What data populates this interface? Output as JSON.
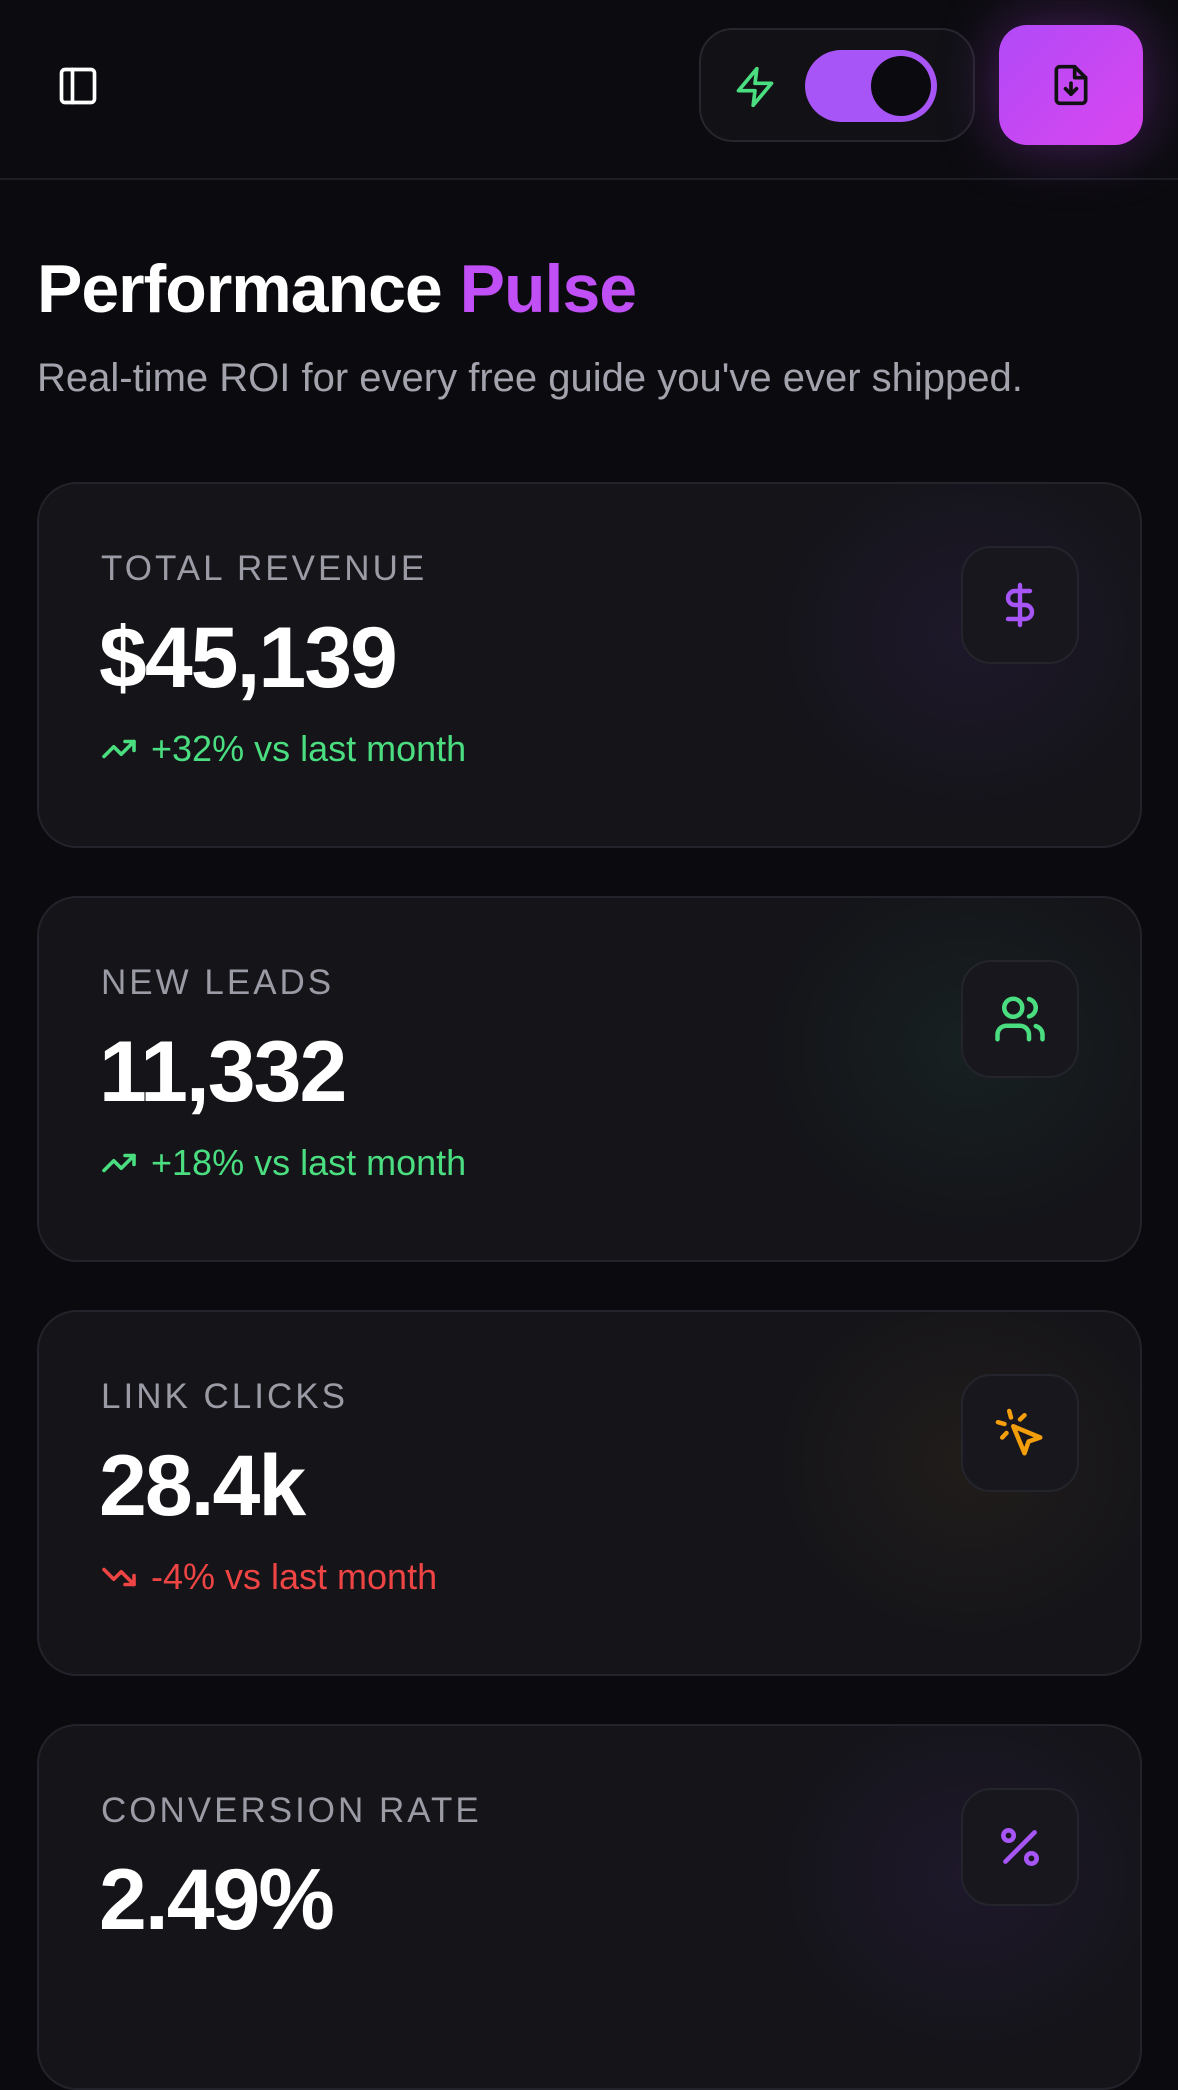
{
  "header": {
    "sidebar_icon": "sidebar-toggle-icon",
    "bolt_icon": "bolt-icon",
    "toggle_on": true,
    "export_icon": "file-download-icon",
    "colors": {
      "toggle": "#a855f7",
      "export_from": "#b14af7",
      "export_to": "#d946ef",
      "bolt": "#4ade80"
    }
  },
  "page": {
    "title_main": "Performance",
    "title_accent": "Pulse",
    "subtitle": "Real-time ROI for every free guide you've ever shipped.",
    "accent_color": "#c04ff5"
  },
  "cards": [
    {
      "label": "TOTAL REVENUE",
      "value": "$45,139",
      "trend": "+32% vs last month",
      "direction": "up",
      "icon": "dollar-icon",
      "icon_color": "#a855f7"
    },
    {
      "label": "NEW LEADS",
      "value": "11,332",
      "trend": "+18% vs last month",
      "direction": "up",
      "icon": "users-icon",
      "icon_color": "#4ade80"
    },
    {
      "label": "LINK CLICKS",
      "value": "28.4k",
      "trend": "-4% vs last month",
      "direction": "down",
      "icon": "cursor-click-icon",
      "icon_color": "#f59e0b"
    },
    {
      "label": "CONVERSION RATE",
      "value": "2.49%",
      "trend": "",
      "direction": "",
      "icon": "percent-icon",
      "icon_color": "#a855f7"
    }
  ],
  "trend_colors": {
    "up": "#4ade80",
    "down": "#ef4444"
  }
}
